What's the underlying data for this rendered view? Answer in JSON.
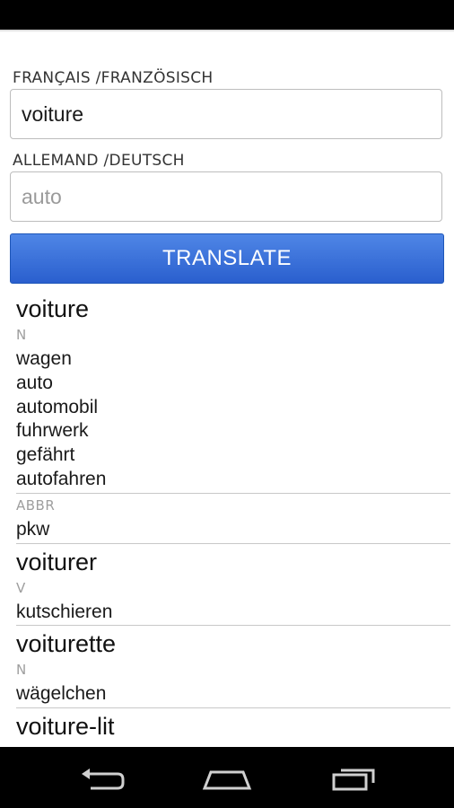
{
  "form": {
    "source_label": "FRANÇAIS /FRANZÖSISCH",
    "source_value": "voiture",
    "target_label": "ALLEMAND /DEUTSCH",
    "target_placeholder": "auto",
    "translate_label": "TRANSLATE"
  },
  "results": [
    {
      "word": "voiture",
      "groups": [
        {
          "pos": "N",
          "translations": [
            "wagen",
            "auto",
            "automobil",
            "fuhrwerk",
            "gefährt",
            "autofahren"
          ]
        },
        {
          "pos": "ABBR",
          "translations": [
            "pkw"
          ]
        }
      ]
    },
    {
      "word": "voiturer",
      "groups": [
        {
          "pos": "V",
          "translations": [
            "kutschieren"
          ]
        }
      ]
    },
    {
      "word": "voiturette",
      "groups": [
        {
          "pos": "N",
          "translations": [
            "wägelchen"
          ]
        }
      ]
    },
    {
      "word": "voiture-lit",
      "groups": []
    }
  ]
}
